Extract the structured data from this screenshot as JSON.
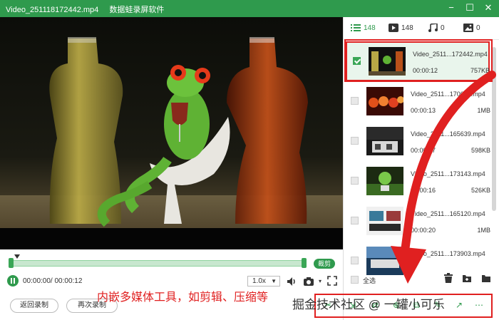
{
  "window": {
    "file_title": "Video_251118172442.mp4",
    "app_title": "数据蛙录屏软件"
  },
  "tabs": [
    {
      "icon": "list-icon",
      "count": "148"
    },
    {
      "icon": "video-icon",
      "count": "148"
    },
    {
      "icon": "music-icon",
      "count": "0"
    },
    {
      "icon": "image-icon",
      "count": "0"
    }
  ],
  "files": [
    {
      "name": "Video_2511...172442.mp4",
      "duration": "00:00:12",
      "size": "757KB",
      "checked": true
    },
    {
      "name": "Video_2511...170633.mp4",
      "duration": "00:00:13",
      "size": "1MB",
      "checked": false
    },
    {
      "name": "Video_2511...165639.mp4",
      "duration": "00:00:17",
      "size": "598KB",
      "checked": false
    },
    {
      "name": "Video_2511...173143.mp4",
      "duration": "00:00:16",
      "size": "526KB",
      "checked": false
    },
    {
      "name": "Video_2511...165120.mp4",
      "duration": "00:00:20",
      "size": "1MB",
      "checked": false
    },
    {
      "name": "Video_2511...173903.mp4",
      "duration": "",
      "size": "",
      "checked": false
    }
  ],
  "player": {
    "time": "00:00:00/ 00:00:12",
    "speed": "1.0x",
    "trim_label": "裁剪"
  },
  "buttons": {
    "back": "返回录制",
    "again": "再次录制"
  },
  "footer": {
    "select_all": "全选"
  },
  "annotations": {
    "bottom": "内嵌多媒体工具，如剪辑、压缩等",
    "watermark": "掘金技术社区 @ 一罐小可乐"
  },
  "colors": {
    "brand_green": "#2f9a4d",
    "annotation_red": "#e02020"
  }
}
